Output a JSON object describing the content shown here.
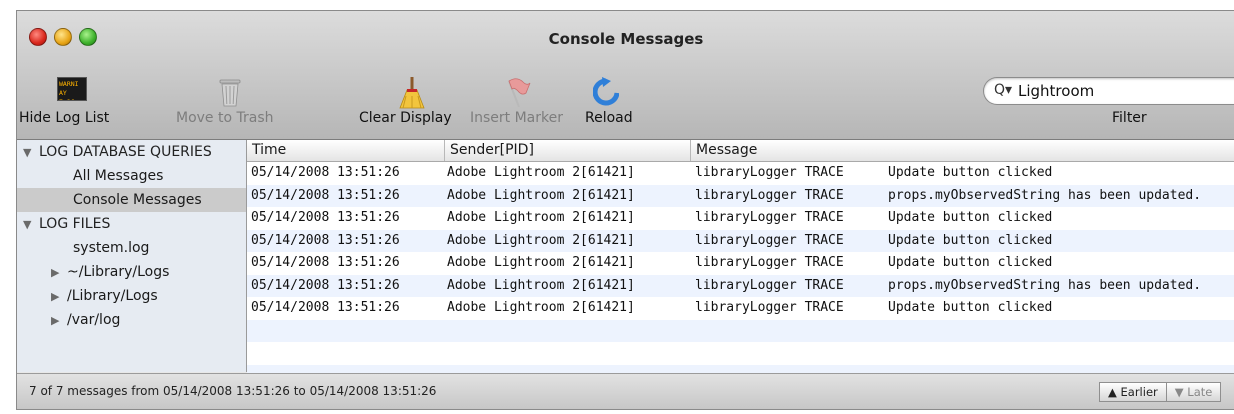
{
  "window": {
    "title": "Console Messages"
  },
  "toolbar": {
    "hide_log_list": "Hide Log List",
    "move_to_trash": "Move to Trash",
    "clear_display": "Clear Display",
    "insert_marker": "Insert Marker",
    "reload": "Reload",
    "warning_icon_line1": "WARNI",
    "warning_icon_line2": "AY 7:36"
  },
  "search": {
    "value": "Lightroom",
    "label": "Filter"
  },
  "sidebar": {
    "items": [
      {
        "label": "LOG DATABASE QUERIES"
      },
      {
        "label": "All Messages"
      },
      {
        "label": "Console Messages"
      },
      {
        "label": "LOG FILES"
      },
      {
        "label": "system.log"
      },
      {
        "label": "~/Library/Logs"
      },
      {
        "label": "/Library/Logs"
      },
      {
        "label": "/var/log"
      }
    ]
  },
  "table": {
    "columns": [
      "Time",
      "Sender[PID]",
      "Message"
    ],
    "rows": [
      {
        "time": "05/14/2008 13:51:26",
        "sender": "Adobe Lightroom 2[61421]",
        "level": "libraryLogger TRACE",
        "message": "Update button clicked"
      },
      {
        "time": "05/14/2008 13:51:26",
        "sender": "Adobe Lightroom 2[61421]",
        "level": "libraryLogger TRACE",
        "message": "props.myObservedString has been updated."
      },
      {
        "time": "05/14/2008 13:51:26",
        "sender": "Adobe Lightroom 2[61421]",
        "level": "libraryLogger TRACE",
        "message": "Update button clicked"
      },
      {
        "time": "05/14/2008 13:51:26",
        "sender": "Adobe Lightroom 2[61421]",
        "level": "libraryLogger TRACE",
        "message": "Update button clicked"
      },
      {
        "time": "05/14/2008 13:51:26",
        "sender": "Adobe Lightroom 2[61421]",
        "level": "libraryLogger TRACE",
        "message": "Update button clicked"
      },
      {
        "time": "05/14/2008 13:51:26",
        "sender": "Adobe Lightroom 2[61421]",
        "level": "libraryLogger TRACE",
        "message": "props.myObservedString has been updated."
      },
      {
        "time": "05/14/2008 13:51:26",
        "sender": "Adobe Lightroom 2[61421]",
        "level": "libraryLogger TRACE",
        "message": "Update button clicked"
      }
    ]
  },
  "status": {
    "text": "7 of 7 messages from 05/14/2008 13:51:26 to 05/14/2008 13:51:26",
    "earlier": "Earlier",
    "later": "Late"
  },
  "colors": {
    "selected_row": "#cbcbcb",
    "alt_row": "#edf3fe",
    "sidebar_bg": "#e6ebf2",
    "reload_blue": "#2f7fd8"
  },
  "icons": [
    "warning-log-icon",
    "trash-icon",
    "broom-icon",
    "flag-marker-icon",
    "reload-icon",
    "search-icon",
    "disclosure-triangle-icon"
  ]
}
